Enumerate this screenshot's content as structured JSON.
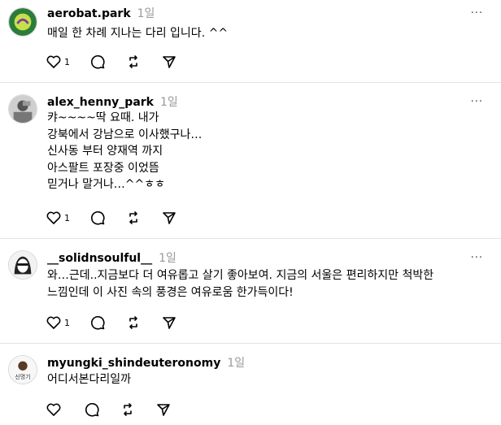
{
  "comments": [
    {
      "username": "aerobat.park",
      "time": "1일",
      "text": "매일 한 차례 지나는 다리 입니다. ^^",
      "likes": "1"
    },
    {
      "username": "alex_henny_park",
      "time": "1일",
      "text": "캬~~~~딱 요때. 내가\n강북에서 강남으로 이사했구나…\n신사동 부터 양재역 까지\n아스팔트 포장중 이었뜸\n믿거나 말거나…^^ㅎㅎ",
      "likes": "1"
    },
    {
      "username": "__solidnsoulful__",
      "time": "1일",
      "text": "와…근데..지금보다 더 여유롭고 살기 좋아보여. 지금의 서울은 편리하지만 척박한\n느낌인데 이 사진 속의 풍경은 여유로움 한가득이다!",
      "likes": "1"
    },
    {
      "username": "myungki_shindeuteronomy",
      "time": "1일",
      "text": "어디서본다리일까",
      "likes": "",
      "avatar_text": "신명기"
    }
  ],
  "more_label": "···",
  "icons": [
    "heart-icon",
    "comment-icon",
    "repost-icon",
    "share-icon",
    "more-icon"
  ]
}
